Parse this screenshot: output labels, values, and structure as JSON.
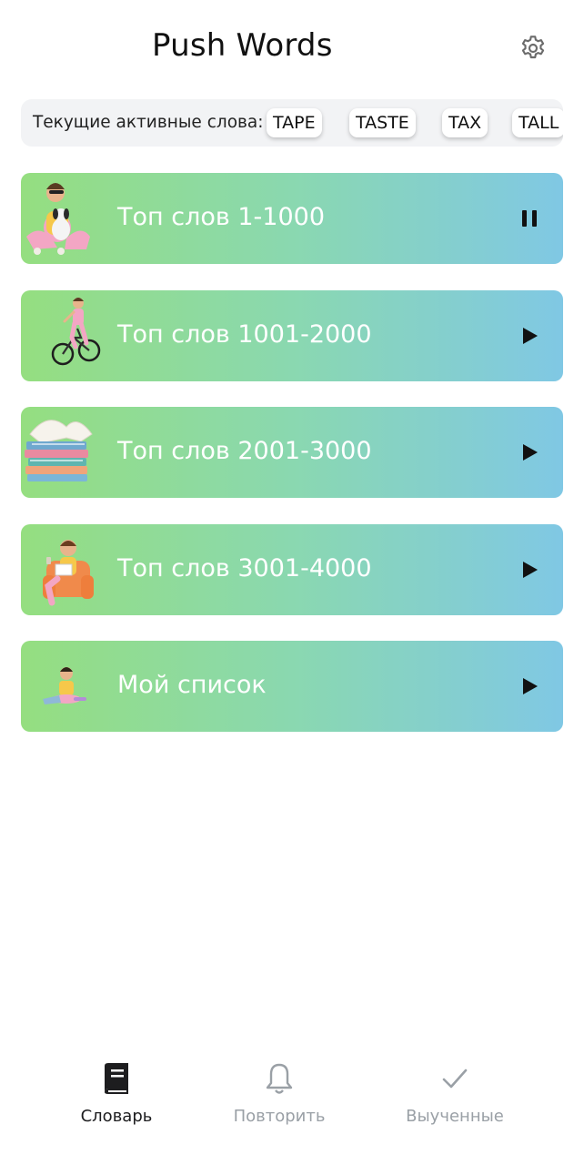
{
  "header": {
    "title": "Push Words",
    "settings_icon": "gear-icon"
  },
  "active_words": {
    "label": "Текущие активные слова:",
    "words": [
      "TAPE",
      "TASTE",
      "TAX",
      "TALL"
    ]
  },
  "cards": [
    {
      "label": "Топ слов 1-1000",
      "state": "playing",
      "action_icon": "pause-icon",
      "art": "woman-with-dog"
    },
    {
      "label": "Топ слов 1001-2000",
      "state": "stopped",
      "action_icon": "play-icon",
      "art": "woman-on-bicycle"
    },
    {
      "label": "Топ слов 2001-3000",
      "state": "stopped",
      "action_icon": "play-icon",
      "art": "book-stack"
    },
    {
      "label": "Топ слов 3001-4000",
      "state": "stopped",
      "action_icon": "play-icon",
      "art": "man-reading-in-armchair"
    },
    {
      "label": "Мой список",
      "state": "stopped",
      "action_icon": "play-icon",
      "art": "boy-with-laptop"
    }
  ],
  "nav": {
    "items": [
      {
        "label": "Словарь",
        "icon": "book-icon",
        "active": true
      },
      {
        "label": "Повторить",
        "icon": "bell-icon",
        "active": false
      },
      {
        "label": "Выученные",
        "icon": "check-icon",
        "active": false
      }
    ]
  },
  "colors": {
    "card_gradient_start": "#95de80",
    "card_gradient_end": "#80c8e4",
    "nav_active": "#1d1d1f",
    "nav_inactive": "#9aa0a6"
  }
}
